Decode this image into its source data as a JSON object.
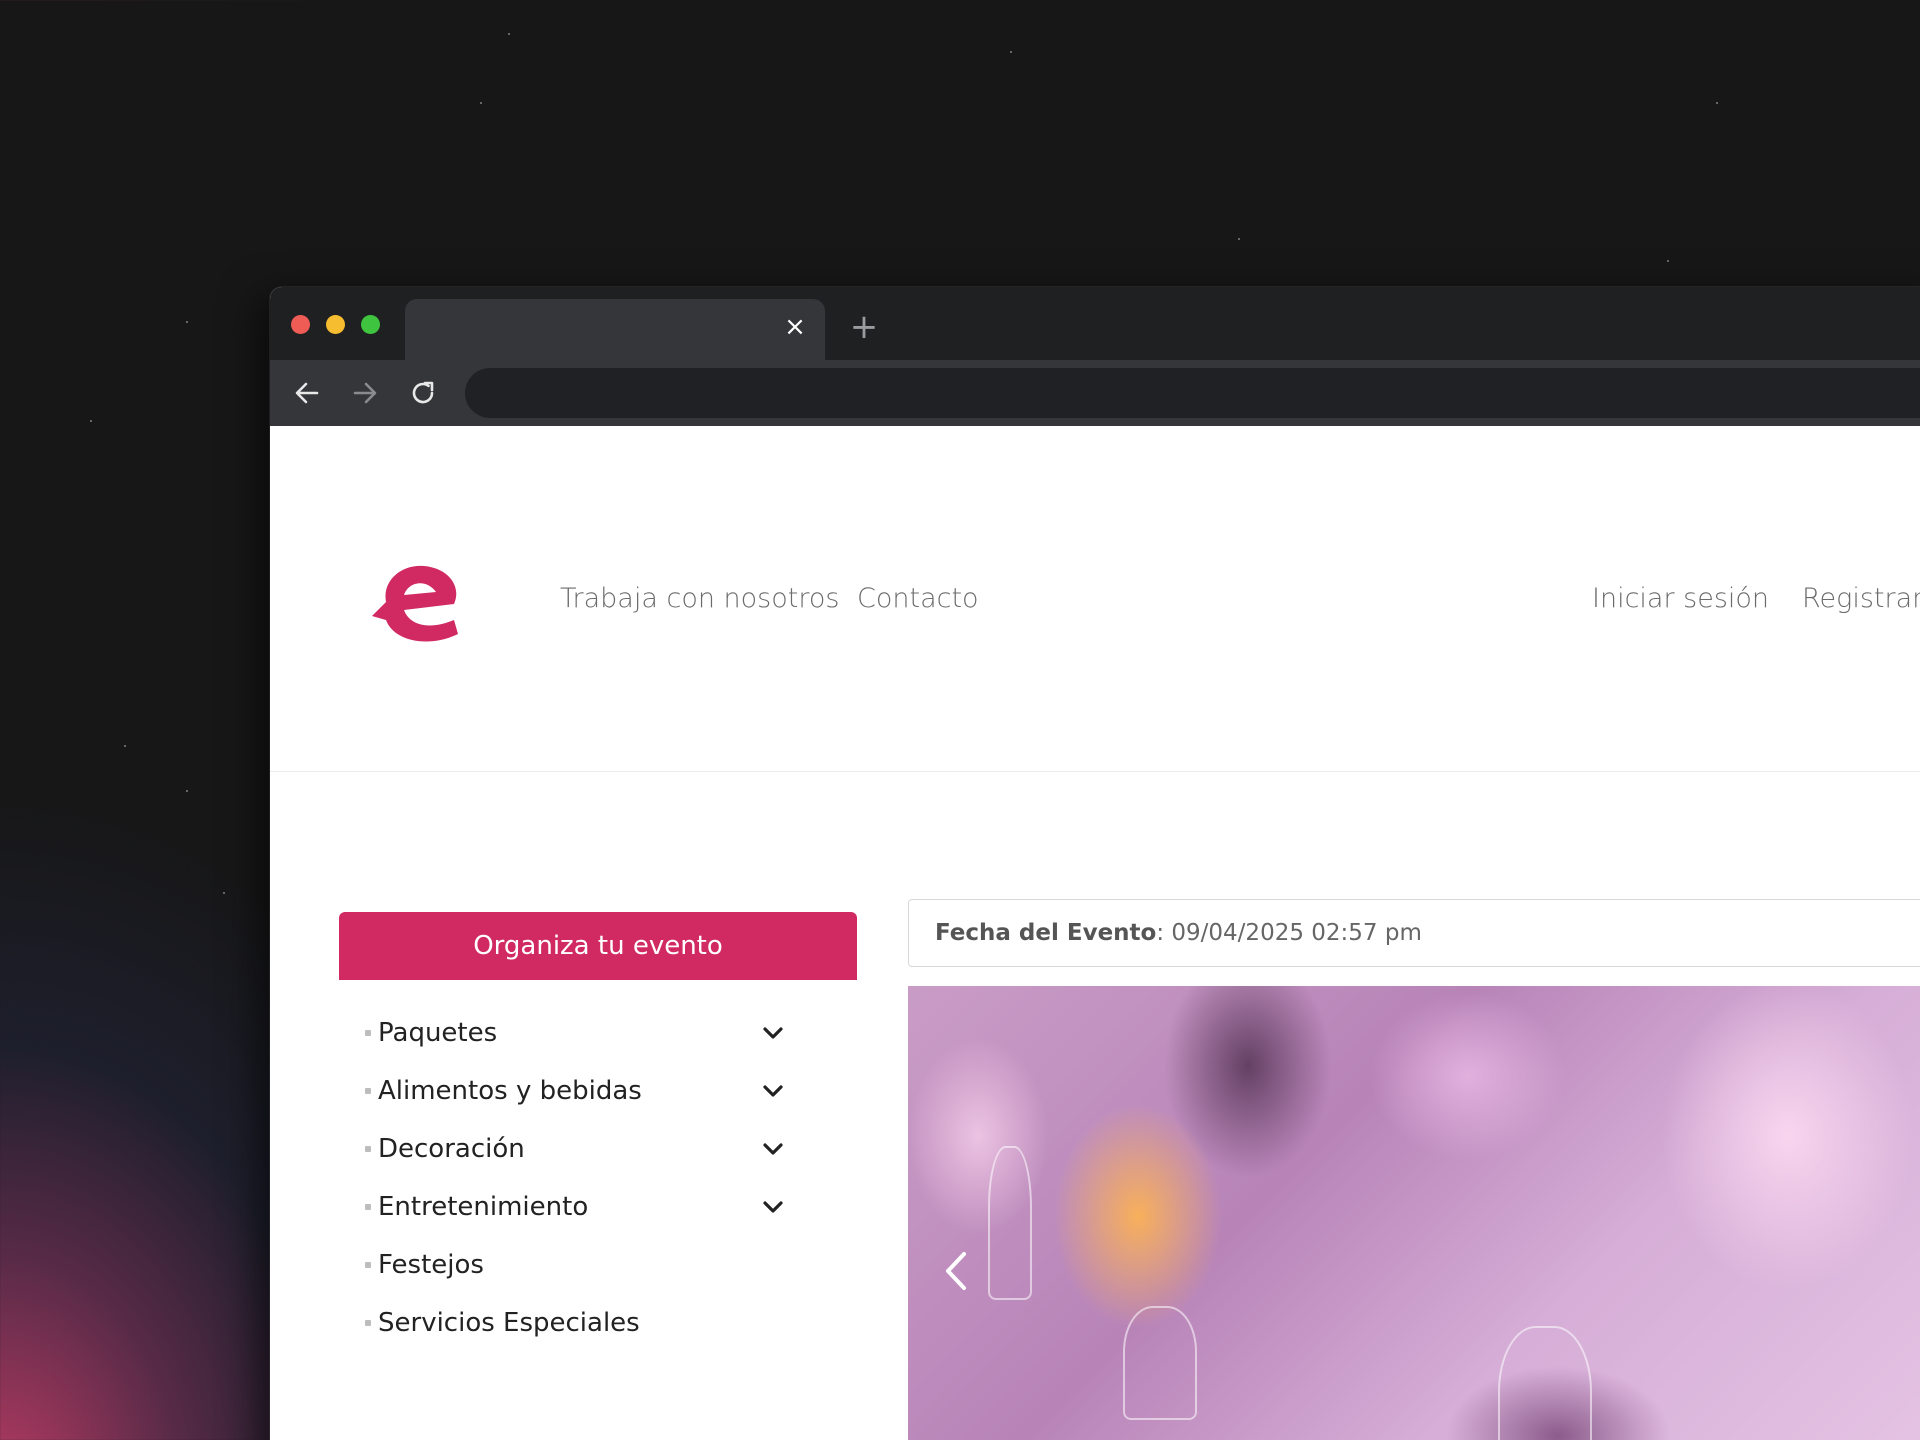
{
  "browser": {
    "tab_title": "",
    "tab_close": "×",
    "new_tab": "+",
    "address": ""
  },
  "header": {
    "logo_letter": "e",
    "nav": {
      "work": "Trabaja con nosotros",
      "contact": "Contacto",
      "login": "Iniciar sesión",
      "register": "Registrarse"
    }
  },
  "sidebar": {
    "cta_label": "Organiza tu evento",
    "items": [
      {
        "label": "Paquetes",
        "expandable": true
      },
      {
        "label": "Alimentos y bebidas",
        "expandable": true
      },
      {
        "label": "Decoración",
        "expandable": true
      },
      {
        "label": "Entretenimiento",
        "expandable": true
      },
      {
        "label": "Festejos",
        "expandable": false
      },
      {
        "label": "Servicios Especiales",
        "expandable": false
      }
    ]
  },
  "event": {
    "date_label": "Fecha del Evento",
    "date_value": ": 09/04/2025 02:57 pm"
  },
  "colors": {
    "brand": "#d12a63",
    "toolbar": "#35363a",
    "titlebar": "#1f2022"
  },
  "icons": {
    "back": "arrow-left-icon",
    "forward": "arrow-right-icon",
    "reload": "reload-icon",
    "chevron": "chevron-down-icon",
    "carousel_prev": "chevron-left-icon"
  }
}
